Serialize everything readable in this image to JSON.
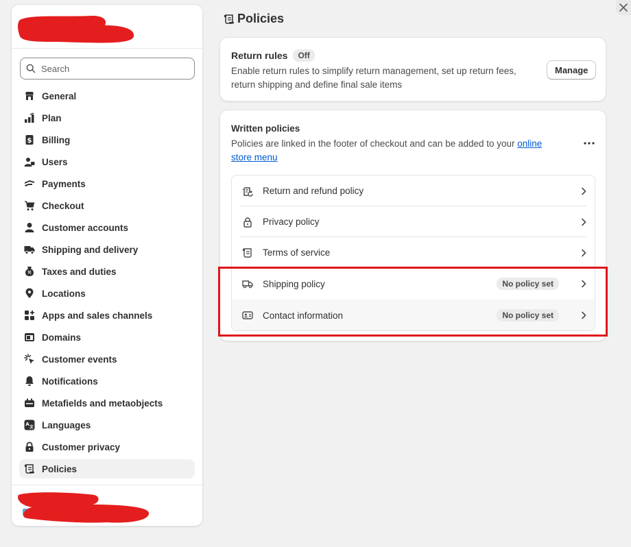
{
  "sidebar": {
    "search_placeholder": "Search",
    "items": [
      {
        "label": "General",
        "icon": "store-icon"
      },
      {
        "label": "Plan",
        "icon": "plan-icon"
      },
      {
        "label": "Billing",
        "icon": "billing-icon"
      },
      {
        "label": "Users",
        "icon": "users-icon"
      },
      {
        "label": "Payments",
        "icon": "payments-icon"
      },
      {
        "label": "Checkout",
        "icon": "cart-icon"
      },
      {
        "label": "Customer accounts",
        "icon": "person-icon"
      },
      {
        "label": "Shipping and delivery",
        "icon": "truck-icon"
      },
      {
        "label": "Taxes and duties",
        "icon": "taxes-icon"
      },
      {
        "label": "Locations",
        "icon": "location-icon"
      },
      {
        "label": "Apps and sales channels",
        "icon": "apps-icon"
      },
      {
        "label": "Domains",
        "icon": "domains-icon"
      },
      {
        "label": "Customer events",
        "icon": "events-icon"
      },
      {
        "label": "Notifications",
        "icon": "bell-icon"
      },
      {
        "label": "Metafields and metaobjects",
        "icon": "metafields-icon"
      },
      {
        "label": "Languages",
        "icon": "language-icon"
      },
      {
        "label": "Customer privacy",
        "icon": "lock-icon"
      },
      {
        "label": "Policies",
        "icon": "policy-icon",
        "active": true
      }
    ]
  },
  "page": {
    "title": "Policies"
  },
  "return_rules": {
    "title": "Return rules",
    "badge": "Off",
    "description": "Enable return rules to simplify return management, set up return fees, return shipping and define final sale items",
    "manage_label": "Manage"
  },
  "written_policies": {
    "title": "Written policies",
    "description_prefix": "Policies are linked in the footer of checkout and can be added to your ",
    "link_text": "online store menu",
    "policies": [
      {
        "label": "Return and refund policy",
        "icon": "return-icon",
        "status": ""
      },
      {
        "label": "Privacy policy",
        "icon": "lock-icon",
        "status": ""
      },
      {
        "label": "Terms of service",
        "icon": "scroll-icon",
        "status": ""
      },
      {
        "label": "Shipping policy",
        "icon": "truck-icon",
        "status": "No policy set"
      },
      {
        "label": "Contact information",
        "icon": "contact-card-icon",
        "status": "No policy set"
      }
    ]
  },
  "colors": {
    "accent_link": "#005bd3",
    "highlight": "#e0141b",
    "redaction": "#e41e1e"
  }
}
